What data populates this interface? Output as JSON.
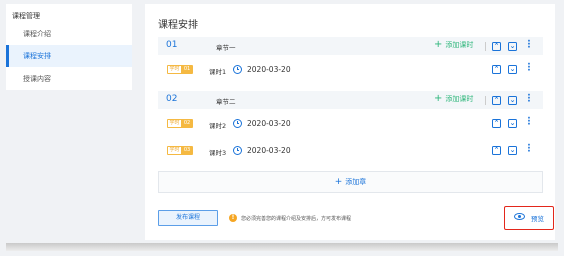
{
  "sidebar": {
    "title": "课程管理",
    "items": [
      {
        "label": "课程介绍",
        "active": false
      },
      {
        "label": "课程安排",
        "active": true
      },
      {
        "label": "授课内容",
        "active": false
      }
    ]
  },
  "main": {
    "title": "课程安排",
    "chapters": [
      {
        "number": "01",
        "name": "章节一",
        "add_lesson_label": "添加课时",
        "lessons": [
          {
            "tag_type": "学时",
            "tag_index": "01",
            "name": "课时1",
            "date": "2020-03-20"
          }
        ]
      },
      {
        "number": "02",
        "name": "章节二",
        "add_lesson_label": "添加课时",
        "lessons": [
          {
            "tag_type": "学时",
            "tag_index": "02",
            "name": "课时2",
            "date": "2020-03-20"
          },
          {
            "tag_type": "学时",
            "tag_index": "03",
            "name": "课时3",
            "date": "2020-03-20"
          }
        ]
      }
    ],
    "add_chapter_label": "添加章",
    "publish_label": "发布课程",
    "warning_text": "您必须完善您的课程介绍及安排后，方可发布课程",
    "preview_label": "预览"
  },
  "colors": {
    "accent": "#1a73d9",
    "green": "#2db67a",
    "tag": "#f5b942",
    "warning": "#f5a623",
    "highlight_border": "#e3271b"
  }
}
